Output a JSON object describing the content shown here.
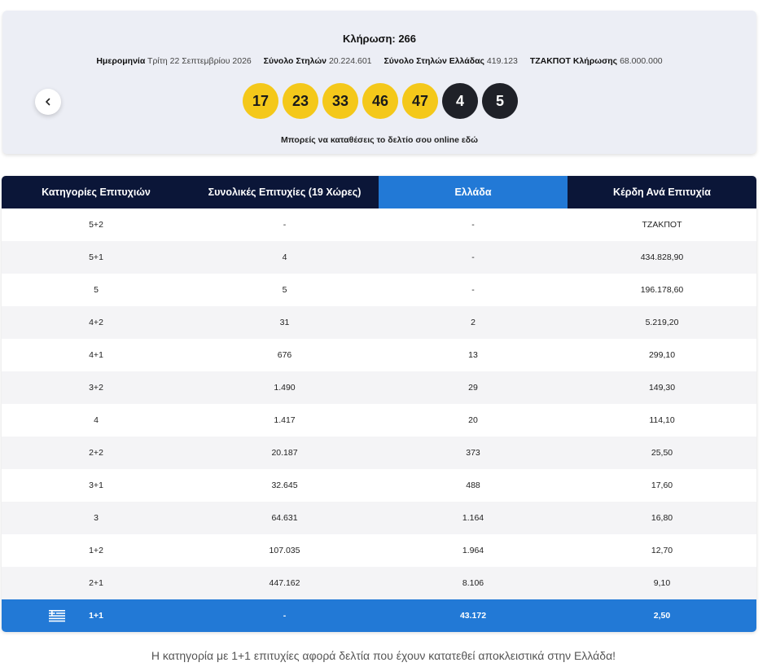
{
  "draw": {
    "title": "Κλήρωση: 266",
    "meta": [
      {
        "label": "Ημερομηνία",
        "value": "Τρίτη 22 Σεπτεμβρίου 2026"
      },
      {
        "label": "Σύνολο Στηλών",
        "value": "20.224.601"
      },
      {
        "label": "Σύνολο Στηλών Ελλάδας",
        "value": "419.123"
      },
      {
        "label": "ΤΖΑΚΠΟΤ Κλήρωσης",
        "value": "68.000.000"
      }
    ],
    "main_numbers": [
      "17",
      "23",
      "33",
      "46",
      "47"
    ],
    "star_numbers": [
      "4",
      "5"
    ],
    "online_note": "Μπορείς να καταθέσεις το δελτίο σου online εδώ",
    "prev_icon": "chevron-left-icon"
  },
  "table": {
    "headers": [
      "Κατηγορίες Επιτυχιών",
      "Συνολικές Επιτυχίες (19 Χώρες)",
      "Ελλάδα",
      "Κέρδη Ανά Επιτυχία"
    ],
    "highlight_color": "#2279d6",
    "header_color": "#0b1638",
    "rows": [
      {
        "category": "5+2",
        "total": "-",
        "greece": "-",
        "prize": "ΤΖΑΚΠΟΤ"
      },
      {
        "category": "5+1",
        "total": "4",
        "greece": "-",
        "prize": "434.828,90"
      },
      {
        "category": "5",
        "total": "5",
        "greece": "-",
        "prize": "196.178,60"
      },
      {
        "category": "4+2",
        "total": "31",
        "greece": "2",
        "prize": "5.219,20"
      },
      {
        "category": "4+1",
        "total": "676",
        "greece": "13",
        "prize": "299,10"
      },
      {
        "category": "3+2",
        "total": "1.490",
        "greece": "29",
        "prize": "149,30"
      },
      {
        "category": "4",
        "total": "1.417",
        "greece": "20",
        "prize": "114,10"
      },
      {
        "category": "2+2",
        "total": "20.187",
        "greece": "373",
        "prize": "25,50"
      },
      {
        "category": "3+1",
        "total": "32.645",
        "greece": "488",
        "prize": "17,60"
      },
      {
        "category": "3",
        "total": "64.631",
        "greece": "1.164",
        "prize": "16,80"
      },
      {
        "category": "1+2",
        "total": "107.035",
        "greece": "1.964",
        "prize": "12,70"
      },
      {
        "category": "2+1",
        "total": "447.162",
        "greece": "8.106",
        "prize": "9,10"
      }
    ],
    "greece_row": {
      "category": "1+1",
      "total": "-",
      "greece": "43.172",
      "prize": "2,50",
      "icon": "greek-flag-icon"
    }
  },
  "footnote": "Η κατηγορία με 1+1 επιτυχίες αφορά δελτία που έχουν κατατεθεί αποκλειστικά στην Ελλάδα!"
}
